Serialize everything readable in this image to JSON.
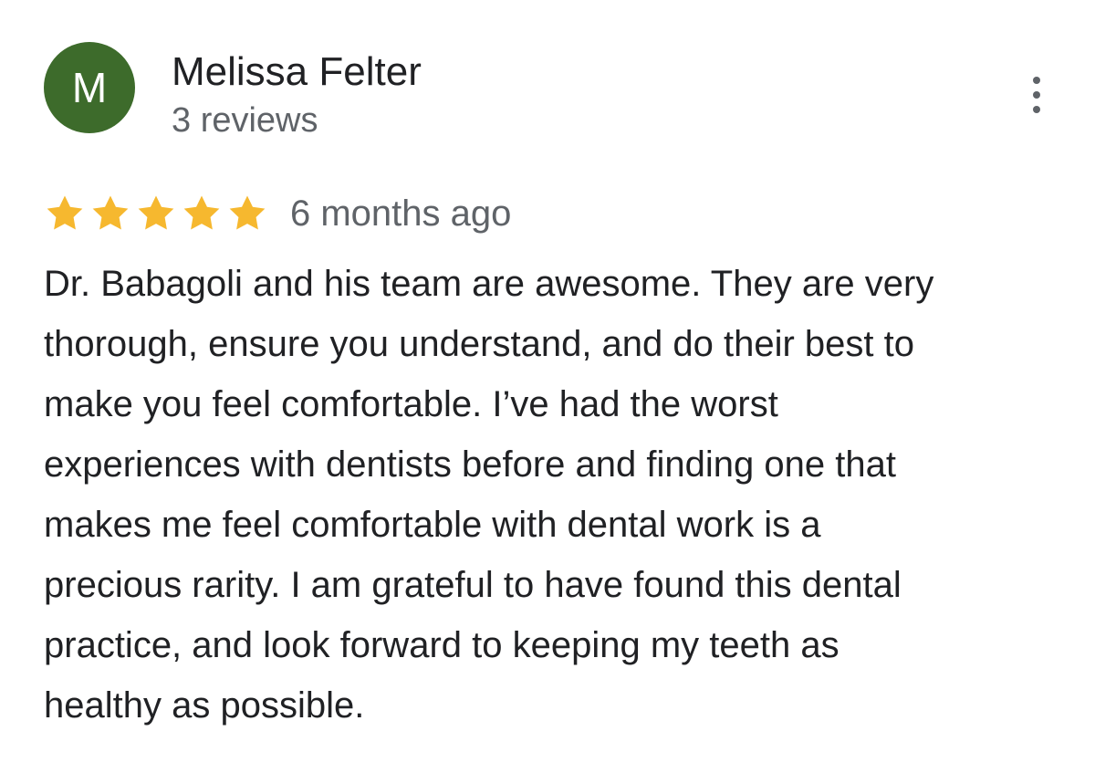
{
  "review": {
    "author": {
      "avatar_initial": "M",
      "avatar_color": "#3d6b2b",
      "name": "Melissa Felter",
      "meta": "3 reviews"
    },
    "menu": {
      "icon": "more-vert-icon"
    },
    "rating": {
      "value": 5,
      "max": 5,
      "star_color": "#f6b82f"
    },
    "date": "6 months ago",
    "text": "Dr. Babagoli and his team are awesome. They are very\nthorough, ensure you understand, and do their best to\nmake you feel comfortable. I’ve had the worst\nexperiences with dentists before and finding one that\nmakes me feel comfortable with dental work is a\nprecious rarity. I am grateful to have found this dental\npractice, and look forward to keeping my teeth as\nhealthy as possible."
  }
}
